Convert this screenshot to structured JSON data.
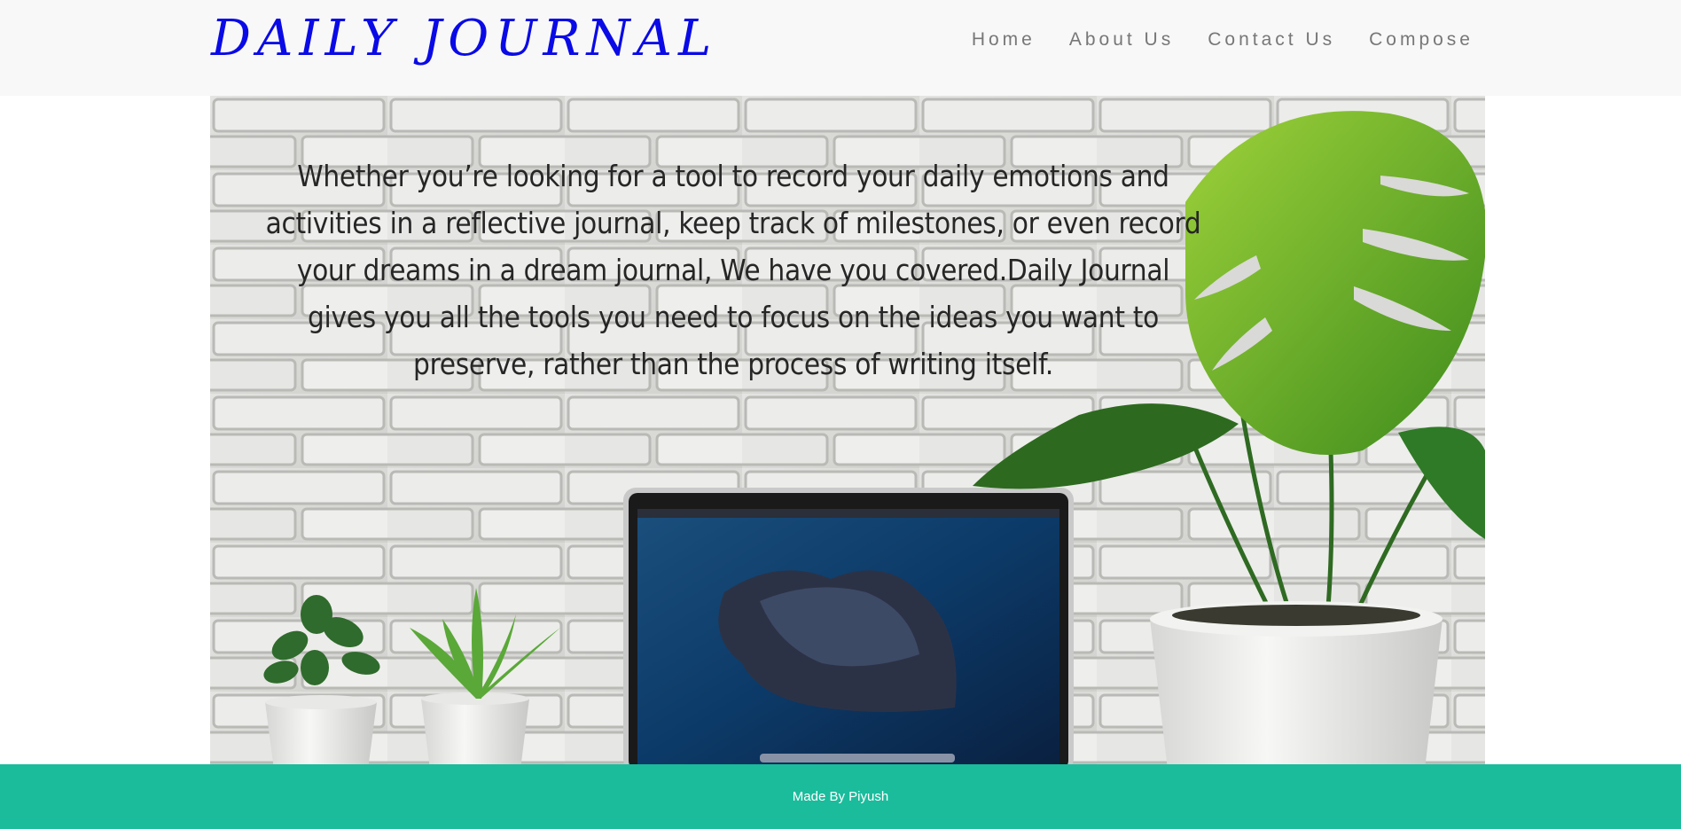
{
  "brand": {
    "title": "DAILY JOURNAL",
    "color": "#0a0ae6"
  },
  "nav": {
    "items": [
      {
        "label": "Home"
      },
      {
        "label": "About Us"
      },
      {
        "label": "Contact Us"
      },
      {
        "label": "Compose"
      }
    ]
  },
  "hero": {
    "text": "Whether you’re looking for a tool to record your daily emotions and activities in a reflective journal, keep track of milestones, or even record your dreams in a dream journal, We have you covered.Daily Journal gives you all the tools you need to focus on the ideas you want to preserve, rather than the process of writing itself."
  },
  "footer": {
    "text": "Made By Piyush",
    "color": "#1abc9c"
  }
}
